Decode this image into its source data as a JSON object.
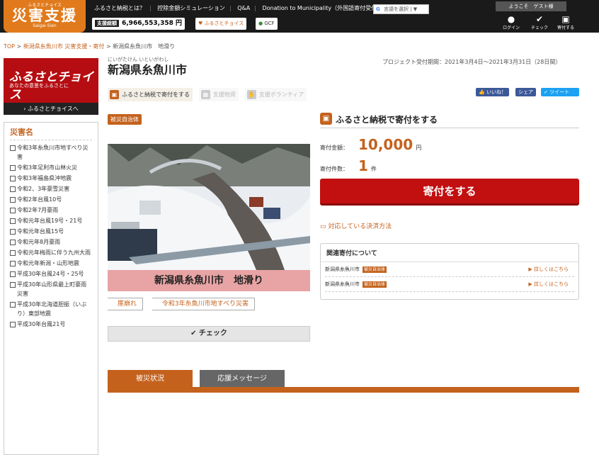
{
  "header": {
    "logo_small": "ふるさとチョイス",
    "logo_main": "災害支援",
    "logo_en": "Saigai-Sien",
    "nav": [
      "ふるさと納税とは？",
      "控除金額シミュレーション",
      "Q&A",
      "Donation to Municipality（外国語寄付受付）"
    ],
    "lang_select": "言語を選択 | ▼",
    "total_label": "支援総額",
    "total_value": "6,966,553,358 円",
    "choice_link": "ふるさとチョイス",
    "gcf_link": "GCF",
    "welcome": "ようこそ　ゲスト様",
    "icons": [
      {
        "name": "login",
        "label": "ログイン"
      },
      {
        "name": "check",
        "label": "チェック"
      },
      {
        "name": "donate",
        "label": "寄付する"
      }
    ]
  },
  "breadcrumb": [
    "TOP",
    "新潟県糸魚川市 災害支援・寄付",
    "新潟県糸魚川市　地滑り"
  ],
  "sidebar": {
    "banner_title": "ふるさとチョイス",
    "banner_sub": "あなたの意思をふるさとに",
    "banner_link": "› ふるさとチョイスへ",
    "category_title": "災害名",
    "items": [
      "令和3年糸魚川市地すべり災害",
      "令和3年足利市山林火災",
      "令和3年福島県沖地震",
      "令和2、3年豪雪災害",
      "令和2年台風10号",
      "令和2年7月豪雨",
      "令和元年台風19号・21号",
      "令和元年台風15号",
      "令和元年8月豪雨",
      "令和元年梅雨に伴う九州大雨",
      "令和元年新潟・山形地震",
      "平成30年台風24号・25号",
      "平成30年山形県最上町豪雨災害",
      "平成30年北海道胆振（いぶり）東部地震",
      "平成30年台風21号"
    ]
  },
  "project": {
    "kana": "にいがたけん いといがわし",
    "title": "新潟県糸魚川市",
    "period": "プロジェクト受付期間：2021年3月4日〜2021年3月31日（28日間）",
    "tabs": [
      "ふるさと納税で寄付をする",
      "支援物資",
      "支援ボランティア"
    ],
    "social": [
      "いいね！",
      "シェア",
      "ツイート"
    ],
    "tag": "被災自治体",
    "caption": "新潟県糸魚川市　地滑り",
    "chips": [
      "崖崩れ",
      "令和3年糸魚川市地すべり災害"
    ],
    "check": "✔ チェック"
  },
  "donate": {
    "heading": "ふるさと納税で寄付をする",
    "amount_label": "寄付金額：",
    "amount": "10,000",
    "amount_unit": "円",
    "count_label": "寄付件数：",
    "count": "1",
    "count_unit": "件",
    "button": "寄付をする",
    "payment": "対応している決済方法",
    "related_title": "関連寄付について",
    "related": [
      {
        "name": "新潟県糸魚川市",
        "badge": "被災自治体",
        "link": "▶ 詳しくはこちら"
      },
      {
        "name": "新潟県糸魚川市",
        "badge": "被災自治体",
        "link": "▶ 詳しくはこちら"
      }
    ]
  },
  "bottom_tabs": [
    "被災状況",
    "応援メッセージ"
  ]
}
